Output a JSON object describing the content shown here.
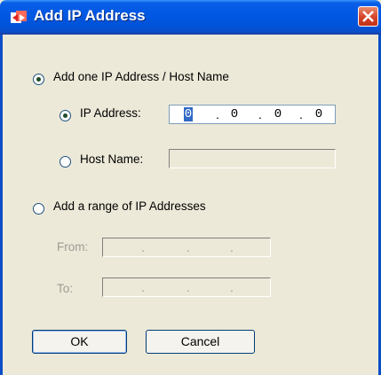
{
  "window": {
    "title": "Add IP Address"
  },
  "add_one": {
    "label": "Add one IP Address / Host Name",
    "ip_label": "IP Address:",
    "ip_octets": [
      "0",
      "0",
      "0",
      "0"
    ],
    "host_label": "Host Name:",
    "host_value": ""
  },
  "add_range": {
    "label": "Add a range of IP Addresses",
    "from_label": "From:",
    "to_label": "To:"
  },
  "buttons": {
    "ok": "OK",
    "cancel": "Cancel"
  },
  "icons": {
    "app": "network-transfer-icon",
    "close": "close-icon"
  },
  "colors": {
    "titlebar": "#0058e4",
    "selection": "#316ac5",
    "face": "#ece9d8"
  }
}
